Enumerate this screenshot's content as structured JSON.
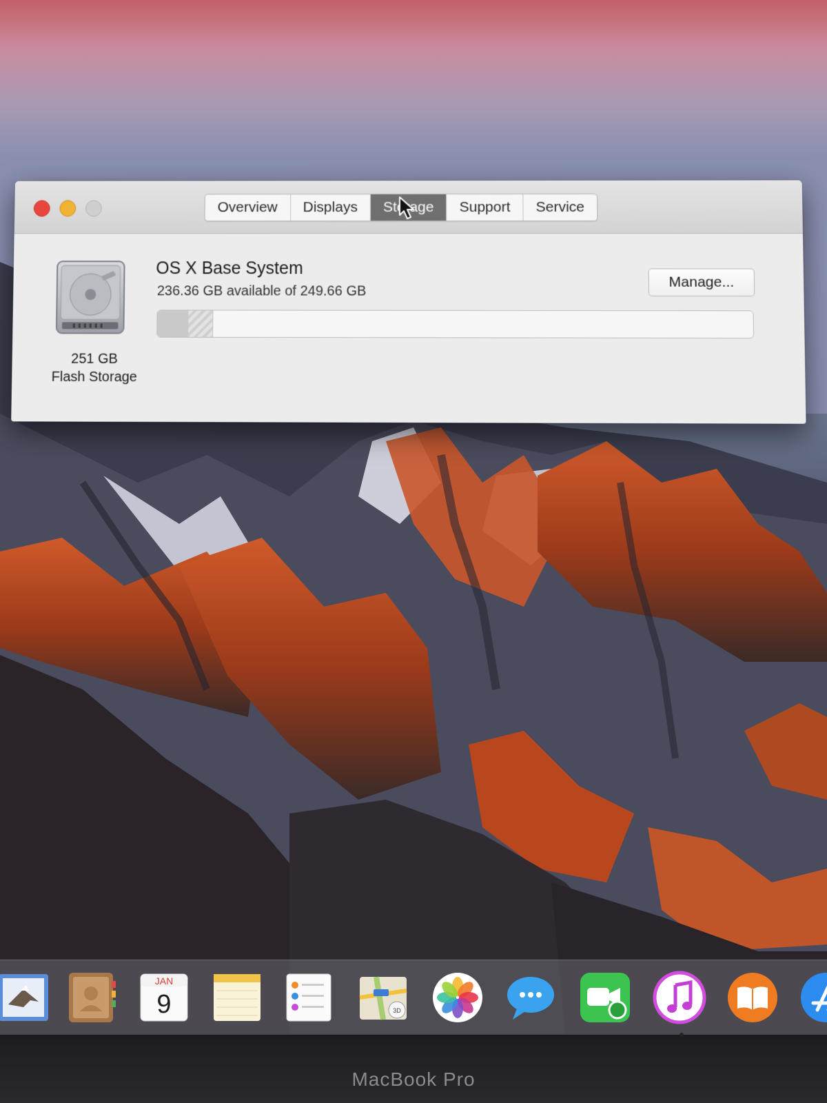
{
  "window": {
    "tabs": [
      {
        "label": "Overview",
        "active": false
      },
      {
        "label": "Displays",
        "active": false
      },
      {
        "label": "Storage",
        "active": true
      },
      {
        "label": "Support",
        "active": false
      },
      {
        "label": "Service",
        "active": false
      }
    ],
    "disk": {
      "size": "251 GB",
      "type": "Flash Storage",
      "icon": "hard-drive-icon"
    },
    "volume": {
      "name": "OS X Base System",
      "availability": "236.36 GB available of 249.66 GB",
      "used_fraction": 0.053,
      "other_fraction": 0.04
    },
    "manage_label": "Manage..."
  },
  "dock": {
    "items": [
      {
        "name": "mail-icon"
      },
      {
        "name": "contacts-icon"
      },
      {
        "name": "calendar-icon",
        "month": "JAN",
        "day": "9"
      },
      {
        "name": "notes-icon"
      },
      {
        "name": "reminders-icon"
      },
      {
        "name": "maps-icon",
        "badge": "3D"
      },
      {
        "name": "photos-icon"
      },
      {
        "name": "messages-icon"
      },
      {
        "name": "facetime-icon"
      },
      {
        "name": "itunes-icon"
      },
      {
        "name": "ibooks-icon"
      },
      {
        "name": "app-store-icon"
      }
    ]
  },
  "device": {
    "brand": "MacBook Pro"
  },
  "colors": {
    "close": "#e9473e",
    "minimize": "#f0b334",
    "zoom": "#cfcfcf",
    "active_tab": "#6f6f6f"
  }
}
